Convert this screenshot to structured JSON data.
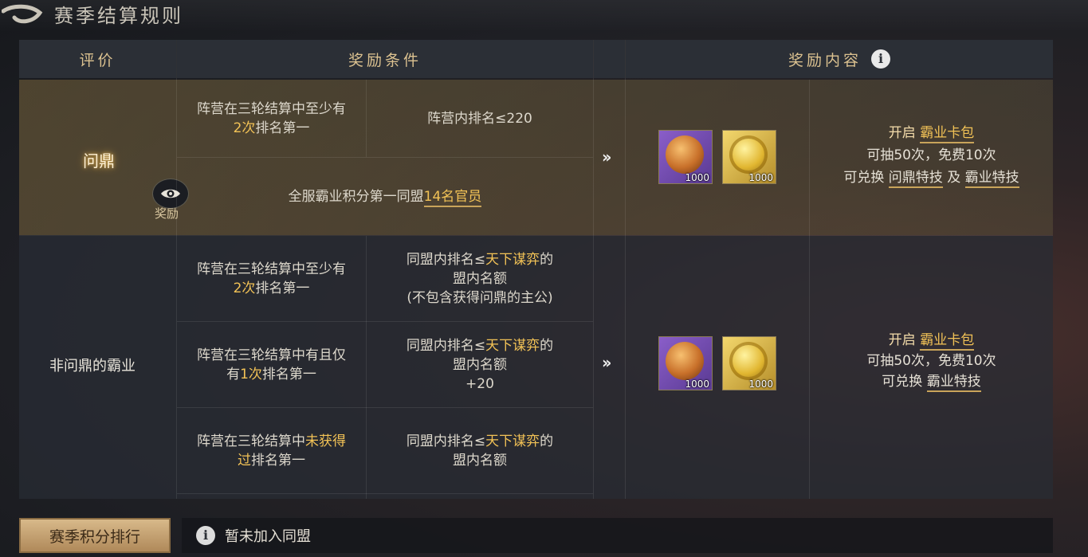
{
  "header": {
    "title": "赛季结算规则"
  },
  "table": {
    "columns": {
      "rating": "评价",
      "conditions": "奖励条件",
      "rewards": "奖励内容"
    },
    "row1": {
      "rating": "问鼎",
      "rating_action": "奖励",
      "cond_a_pre": "阵营在三轮结算中至少有",
      "cond_a_hi": "2次",
      "cond_a_post": "排名第一",
      "cond_b": "阵营内排名≤220",
      "cond_c_pre": "全服霸业积分第一同盟",
      "cond_c_link": "14名官员",
      "items": [
        {
          "icon": "purple-token",
          "qty": "1000"
        },
        {
          "icon": "gold-coin",
          "qty": "1000"
        }
      ],
      "reward_open": "开启 ",
      "reward_pack": "霸业卡包",
      "reward_draws": "可抽50次，免费10次",
      "reward_exchange": "可兑换 ",
      "reward_skill1": "问鼎特技",
      "reward_and": " 及 ",
      "reward_skill2": "霸业特技"
    },
    "row2": {
      "rating": "非问鼎的霸业",
      "sub1_pre": "阵营在三轮结算中至少有",
      "sub1_hi": "2次",
      "sub1_post": "排名第一",
      "sub1_cond_pre": "同盟内排名≤",
      "sub1_cond_hi": "天下谋弈",
      "sub1_cond_post": "的",
      "sub1_cond_line2": "盟内名额",
      "sub1_cond_line3": "(不包含获得问鼎的主公)",
      "sub2_pre": "阵营在三轮结算中有且仅有",
      "sub2_hi": "1次",
      "sub2_post": "排名第一",
      "sub2_cond_pre": "同盟内排名≤",
      "sub2_cond_hi": "天下谋弈",
      "sub2_cond_post": "的",
      "sub2_cond_line2": "盟内名额",
      "sub2_cond_line3": "+20",
      "sub3_pre": "阵营在三轮结算中",
      "sub3_hi": "未获得过",
      "sub3_post": "排名第一",
      "sub3_cond_pre": "同盟内排名≤",
      "sub3_cond_hi": "天下谋弈",
      "sub3_cond_post": "的",
      "sub3_cond_line2": "盟内名额",
      "items": [
        {
          "icon": "purple-token",
          "qty": "1000"
        },
        {
          "icon": "gold-coin",
          "qty": "1000"
        }
      ],
      "reward_open": "开启 ",
      "reward_pack": "霸业卡包",
      "reward_draws": "可抽50次，免费10次",
      "reward_exchange": "可兑换 ",
      "reward_skill": "霸业特技"
    }
  },
  "footer": {
    "ranking_button": "赛季积分排行",
    "status": "暂未加入同盟"
  },
  "colors": {
    "accent_gold": "#f2c256",
    "header_text": "#dcc290"
  }
}
